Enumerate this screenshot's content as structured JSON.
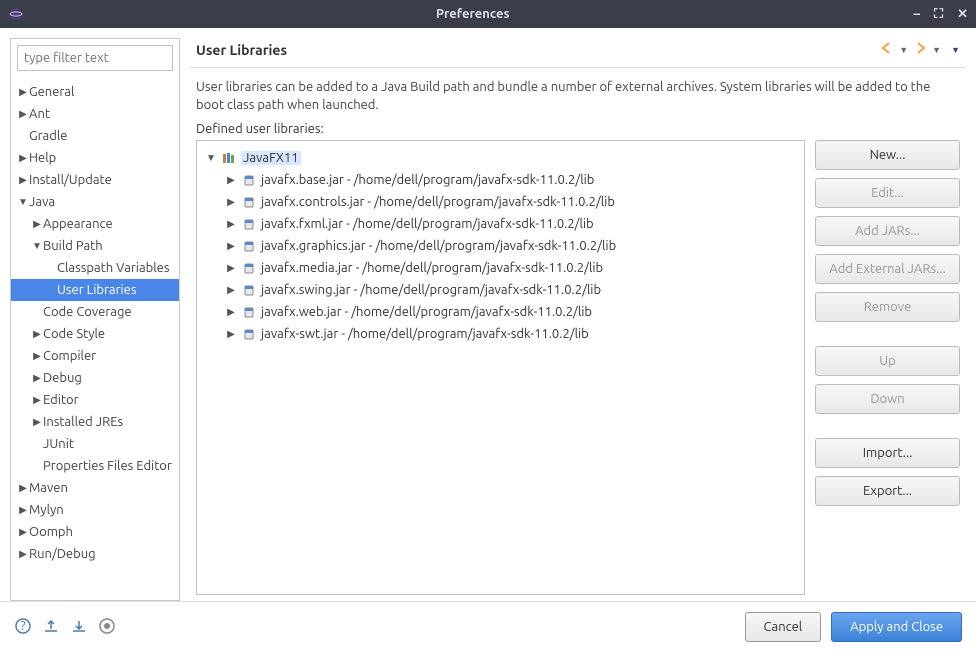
{
  "titlebar": {
    "title": "Preferences"
  },
  "filter_placeholder": "type filter text",
  "tree": [
    {
      "label": "General",
      "level": 1,
      "expandable": true,
      "expanded": false
    },
    {
      "label": "Ant",
      "level": 1,
      "expandable": true,
      "expanded": false
    },
    {
      "label": "Gradle",
      "level": 1,
      "expandable": false
    },
    {
      "label": "Help",
      "level": 1,
      "expandable": true,
      "expanded": false
    },
    {
      "label": "Install/Update",
      "level": 1,
      "expandable": true,
      "expanded": false
    },
    {
      "label": "Java",
      "level": 1,
      "expandable": true,
      "expanded": true
    },
    {
      "label": "Appearance",
      "level": 2,
      "expandable": true,
      "expanded": false
    },
    {
      "label": "Build Path",
      "level": 2,
      "expandable": true,
      "expanded": true
    },
    {
      "label": "Classpath Variables",
      "level": 3,
      "expandable": false
    },
    {
      "label": "User Libraries",
      "level": 3,
      "expandable": false,
      "selected": true
    },
    {
      "label": "Code Coverage",
      "level": 2,
      "expandable": false
    },
    {
      "label": "Code Style",
      "level": 2,
      "expandable": true,
      "expanded": false
    },
    {
      "label": "Compiler",
      "level": 2,
      "expandable": true,
      "expanded": false
    },
    {
      "label": "Debug",
      "level": 2,
      "expandable": true,
      "expanded": false
    },
    {
      "label": "Editor",
      "level": 2,
      "expandable": true,
      "expanded": false
    },
    {
      "label": "Installed JREs",
      "level": 2,
      "expandable": true,
      "expanded": false
    },
    {
      "label": "JUnit",
      "level": 2,
      "expandable": false
    },
    {
      "label": "Properties Files Editor",
      "level": 2,
      "expandable": false
    },
    {
      "label": "Maven",
      "level": 1,
      "expandable": true,
      "expanded": false
    },
    {
      "label": "Mylyn",
      "level": 1,
      "expandable": true,
      "expanded": false
    },
    {
      "label": "Oomph",
      "level": 1,
      "expandable": true,
      "expanded": false
    },
    {
      "label": "Run/Debug",
      "level": 1,
      "expandable": true,
      "expanded": false
    }
  ],
  "page": {
    "title": "User Libraries",
    "description": "User libraries can be added to a Java Build path and bundle a number of external archives. System libraries will be added to the boot class path when launched.",
    "defined_label": "Defined user libraries:",
    "library": {
      "name": "JavaFX11",
      "jars": [
        {
          "file": "javafx.base.jar",
          "path": "/home/dell/program/javafx-sdk-11.0.2/lib"
        },
        {
          "file": "javafx.controls.jar",
          "path": "/home/dell/program/javafx-sdk-11.0.2/lib"
        },
        {
          "file": "javafx.fxml.jar",
          "path": "/home/dell/program/javafx-sdk-11.0.2/lib"
        },
        {
          "file": "javafx.graphics.jar",
          "path": "/home/dell/program/javafx-sdk-11.0.2/lib"
        },
        {
          "file": "javafx.media.jar",
          "path": "/home/dell/program/javafx-sdk-11.0.2/lib"
        },
        {
          "file": "javafx.swing.jar",
          "path": "/home/dell/program/javafx-sdk-11.0.2/lib"
        },
        {
          "file": "javafx.web.jar",
          "path": "/home/dell/program/javafx-sdk-11.0.2/lib"
        },
        {
          "file": "javafx-swt.jar",
          "path": "/home/dell/program/javafx-sdk-11.0.2/lib"
        }
      ]
    },
    "buttons": {
      "new": "New...",
      "edit": "Edit...",
      "add_jars": "Add JARs...",
      "add_ext": "Add External JARs...",
      "remove": "Remove",
      "up": "Up",
      "down": "Down",
      "import": "Import...",
      "export": "Export..."
    }
  },
  "footer": {
    "cancel": "Cancel",
    "apply": "Apply and Close"
  }
}
